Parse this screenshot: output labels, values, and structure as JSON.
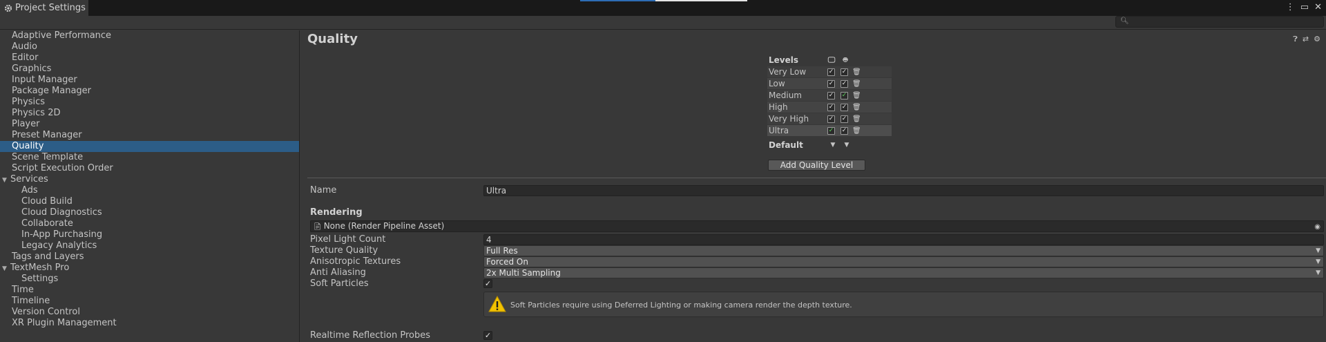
{
  "window": {
    "tab_title": "Project Settings",
    "controls": [
      "⋮",
      "▭",
      "✕"
    ],
    "progress": 0.45
  },
  "search": {
    "placeholder": ""
  },
  "sidebar": {
    "items": [
      {
        "label": "Adaptive Performance",
        "level": 0
      },
      {
        "label": "Audio",
        "level": 0
      },
      {
        "label": "Editor",
        "level": 0
      },
      {
        "label": "Graphics",
        "level": 0
      },
      {
        "label": "Input Manager",
        "level": 0
      },
      {
        "label": "Package Manager",
        "level": 0
      },
      {
        "label": "Physics",
        "level": 0
      },
      {
        "label": "Physics 2D",
        "level": 0
      },
      {
        "label": "Player",
        "level": 0
      },
      {
        "label": "Preset Manager",
        "level": 0
      },
      {
        "label": "Quality",
        "level": 0,
        "selected": true
      },
      {
        "label": "Scene Template",
        "level": 0
      },
      {
        "label": "Script Execution Order",
        "level": 0
      },
      {
        "label": "Services",
        "level": 0,
        "expanded": true
      },
      {
        "label": "Ads",
        "level": 1
      },
      {
        "label": "Cloud Build",
        "level": 1
      },
      {
        "label": "Cloud Diagnostics",
        "level": 1
      },
      {
        "label": "Collaborate",
        "level": 1
      },
      {
        "label": "In-App Purchasing",
        "level": 1
      },
      {
        "label": "Legacy Analytics",
        "level": 1
      },
      {
        "label": "Tags and Layers",
        "level": 0
      },
      {
        "label": "TextMesh Pro",
        "level": 0,
        "expanded": true
      },
      {
        "label": "Settings",
        "level": 1
      },
      {
        "label": "Time",
        "level": 0
      },
      {
        "label": "Timeline",
        "level": 0
      },
      {
        "label": "Version Control",
        "level": 0
      },
      {
        "label": "XR Plugin Management",
        "level": 0
      }
    ]
  },
  "main": {
    "title": "Quality",
    "levels": {
      "header": "Levels",
      "platforms": [
        "desktop-icon",
        "android-icon"
      ],
      "rows": [
        {
          "name": "Very Low",
          "desktop": "check",
          "android": "check"
        },
        {
          "name": "Low",
          "desktop": "check",
          "android": "check"
        },
        {
          "name": "Medium",
          "desktop": "check",
          "android": "default"
        },
        {
          "name": "High",
          "desktop": "check",
          "android": "check"
        },
        {
          "name": "Very High",
          "desktop": "check",
          "android": "check"
        },
        {
          "name": "Ultra",
          "desktop": "default",
          "android": "check",
          "selected": true
        }
      ],
      "default_label": "Default",
      "add_button": "Add Quality Level"
    },
    "name_label": "Name",
    "name_value": "Ultra",
    "rendering_header": "Rendering",
    "pipeline_asset": "None (Render Pipeline Asset)",
    "pixel_light_count_label": "Pixel Light Count",
    "pixel_light_count_value": "4",
    "texture_quality_label": "Texture Quality",
    "texture_quality_value": "Full Res",
    "aniso_label": "Anisotropic Textures",
    "aniso_value": "Forced On",
    "anti_alias_label": "Anti Aliasing",
    "anti_alias_value": "2x Multi Sampling",
    "soft_particles_label": "Soft Particles",
    "soft_particles_help": "Soft Particles require using Deferred Lighting or making camera render the depth texture.",
    "realtime_reflection_label": "Realtime Reflection Probes"
  },
  "colors": {
    "selection": "#2c5d87",
    "background": "#383838",
    "warning": "#f2c200",
    "default_check": "#5cd65c"
  }
}
